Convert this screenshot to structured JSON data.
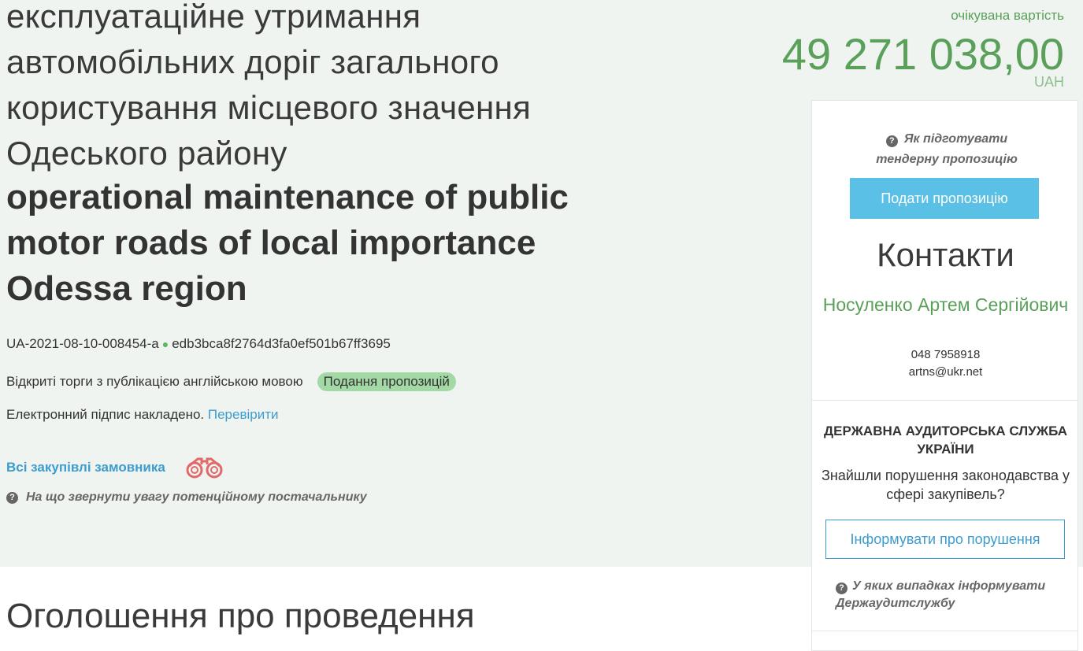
{
  "tender": {
    "title_ua": "експлуатаційне утримання автомобільних доріг загального користування місцевого значення Одеського району",
    "title_en": "operational maintenance of public motor roads of local importance Odessa region",
    "tender_id": "UA-2021-08-10-008454-a",
    "hash": "edb3bca8f2764d3fa0ef501b67ff3695",
    "procedure_type": "Відкриті торги з публікацією англійською мовою",
    "status_badge": "Подання пропозицій",
    "signature_text": "Електронний підпис накладено.",
    "signature_link": "Перевірити",
    "all_purchases_link": "Всі закупівлі замовника",
    "attention_text": "На що звернути увагу потенційному постачальнику",
    "announcement_heading": "Оголошення про проведення"
  },
  "cost": {
    "label": "очікувана вартість",
    "value": "49 271 038,00",
    "currency": "UAH"
  },
  "sidebar": {
    "help_tender_text": "Як підготувати тендерну пропозицію",
    "submit_button": "Подати пропозицію",
    "contacts_title": "Контакти",
    "contact_name": "Носуленко Артем Сергійович",
    "contact_phone": "048 7958918",
    "contact_email": "artns@ukr.net",
    "audit_title": "ДЕРЖАВНА АУДИТОРСЬКА СЛУЖБА УКРАЇНИ",
    "audit_text": "Знайшли порушення законодавства у сфері закупівель?",
    "inform_button": "Інформувати про порушення",
    "help_audit_text": "У яких випадках інформувати Держаудитслужбу"
  },
  "colors": {
    "accent_green": "#5aa05a",
    "link_blue": "#3c9ccf",
    "button_blue": "#5bc0e6",
    "badge_green": "#a3d9a5"
  },
  "icons": [
    "question-icon",
    "binoculars-icon",
    "status-dot-icon"
  ]
}
